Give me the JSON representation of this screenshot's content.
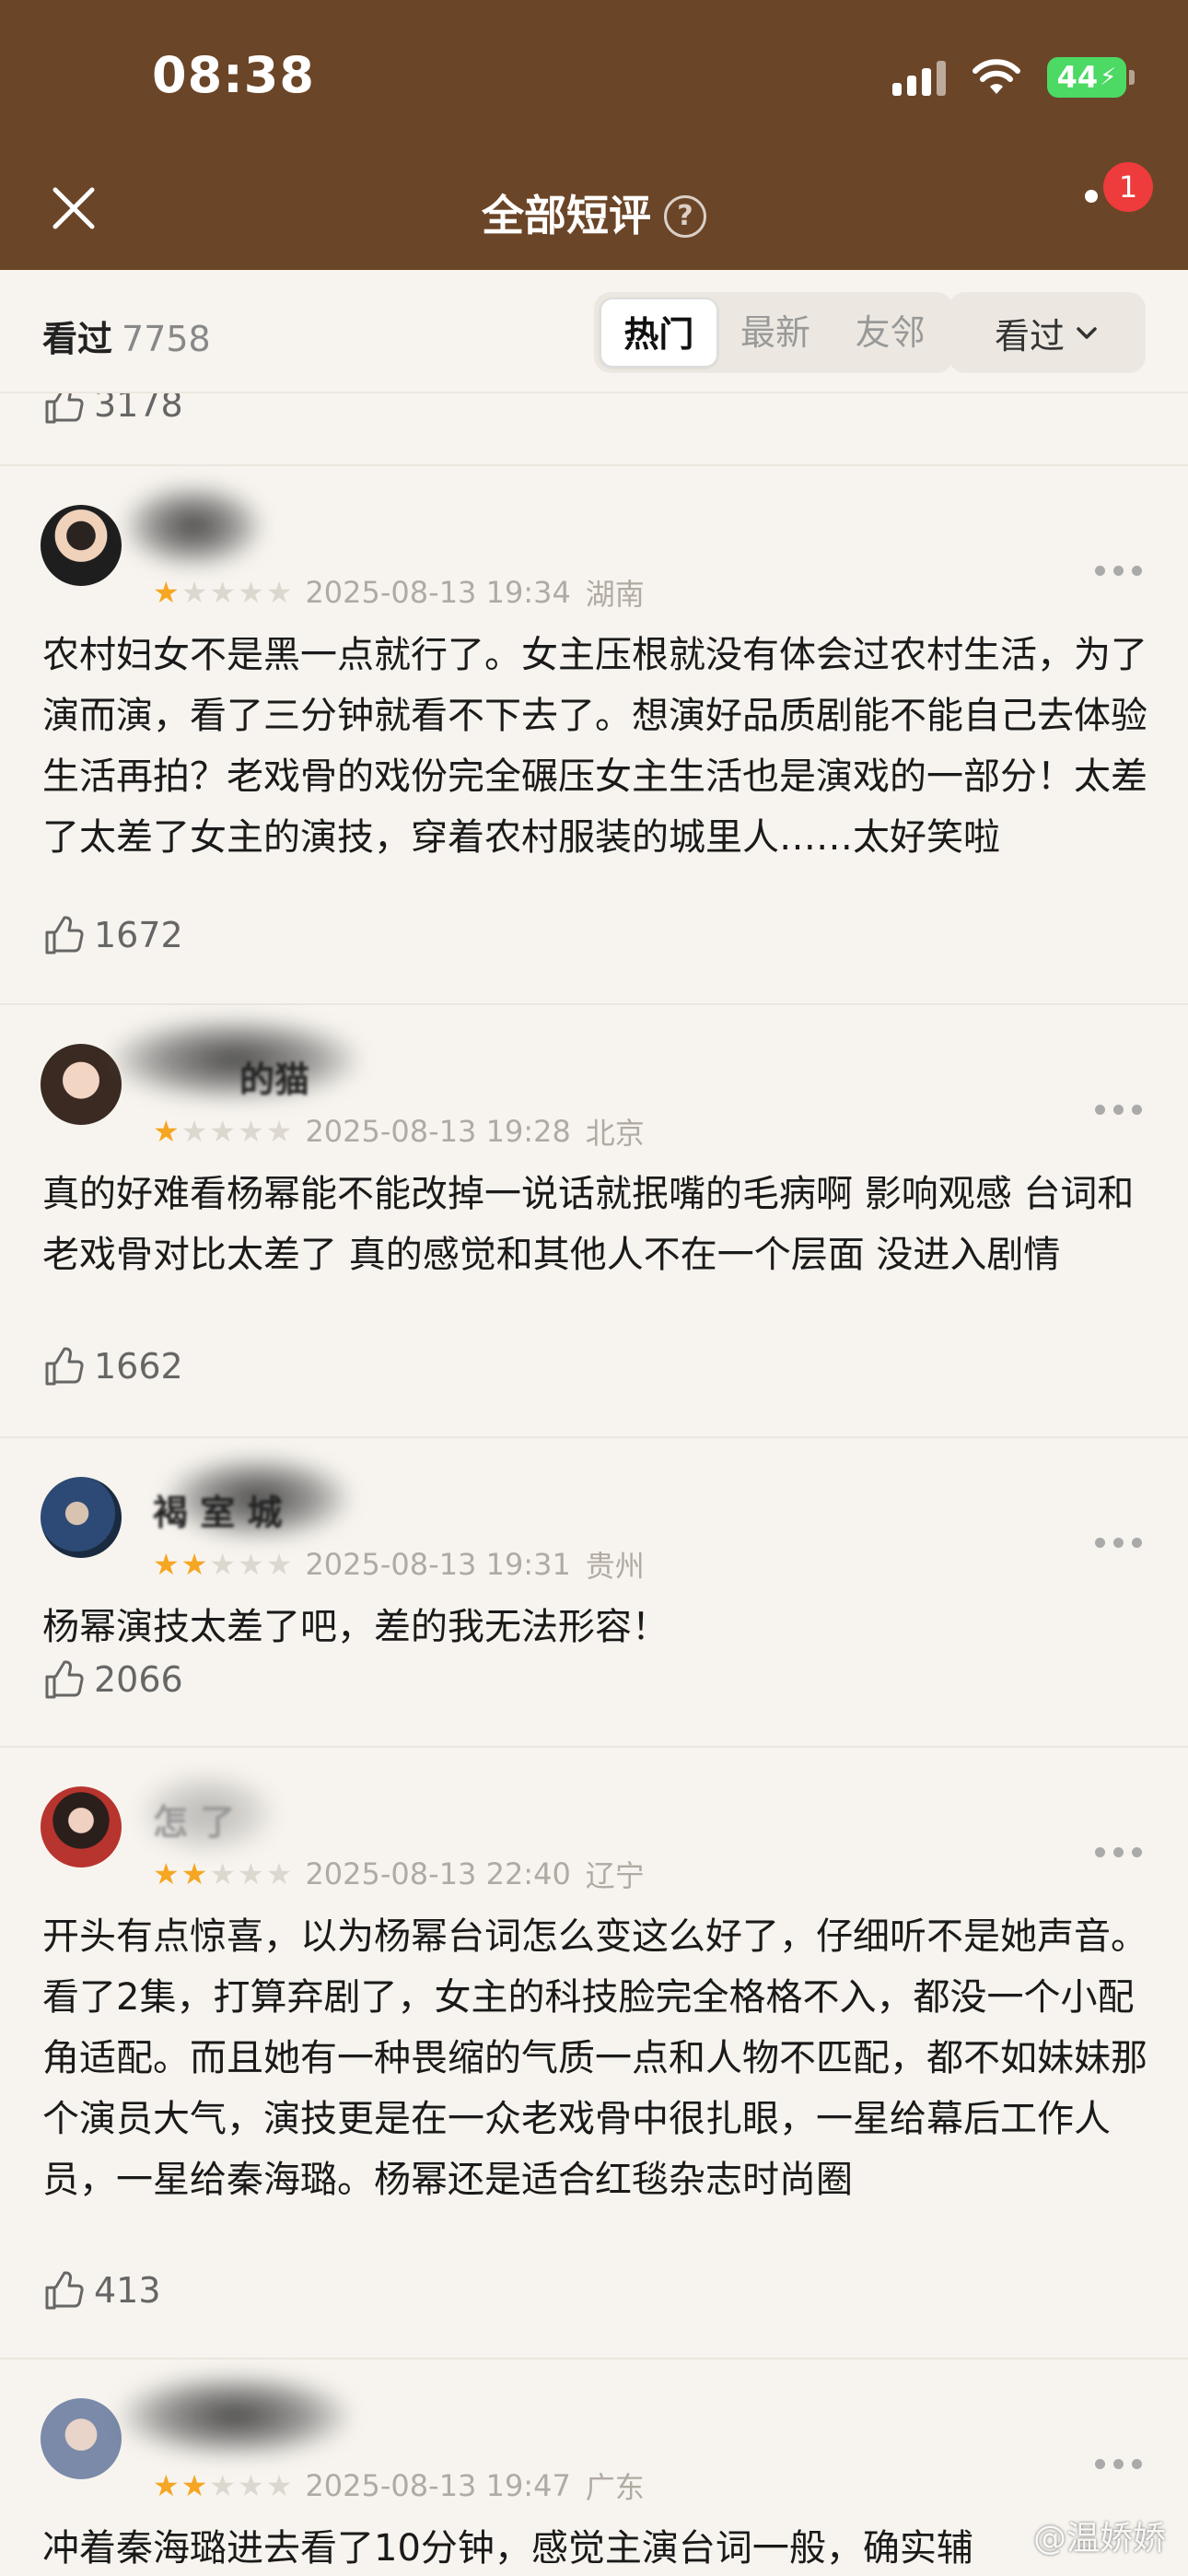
{
  "status": {
    "time": "08:38",
    "battery": "44"
  },
  "nav": {
    "title": "全部短评",
    "help": "?",
    "badge": "1"
  },
  "filter": {
    "seen_label": "看过",
    "seen_count": "7758",
    "tabs": [
      "热门",
      "最新",
      "友邻"
    ],
    "dropdown": "看过"
  },
  "top_like_count": "3178",
  "comments": [
    {
      "name": "",
      "stars": 1,
      "date": "2025-08-13 19:34",
      "location": "湖南",
      "text": "农村妇女不是黑一点就行了。女主压根就没有体会过农村生活，为了演而演，看了三分钟就看不下去了。想演好品质剧能不能自己去体验生活再拍？老戏骨的戏份完全碾压女主生活也是演戏的一部分！太差了太差了女主的演技，穿着农村服装的城里人……太好笑啦",
      "likes": "1672"
    },
    {
      "name": "的猫",
      "stars": 1,
      "date": "2025-08-13 19:28",
      "location": "北京",
      "text": "真的好难看杨幂能不能改掉一说话就抿嘴的毛病啊 影响观感 台词和老戏骨对比太差了 真的感觉和其他人不在一个层面 没进入剧情",
      "likes": "1662"
    },
    {
      "name": "褐  室  城",
      "stars": 2,
      "date": "2025-08-13 19:31",
      "location": "贵州",
      "text": "杨幂演技太差了吧，差的我无法形容！",
      "likes": "2066"
    },
    {
      "name": "怎  了",
      "stars": 2,
      "date": "2025-08-13 22:40",
      "location": "辽宁",
      "text": "开头有点惊喜，以为杨幂台词怎么变这么好了，仔细听不是她声音。看了2集，打算弃剧了，女主的科技脸完全格格不入，都没一个小配角适配。而且她有一种畏缩的气质一点和人物不匹配，都不如妹妹那个演员大气，演技更是在一众老戏骨中很扎眼，一星给幕后工作人员，一星给秦海璐。杨幂还是适合红毯杂志时尚圈",
      "likes": "413"
    },
    {
      "name": "",
      "stars": 2,
      "date": "2025-08-13 19:47",
      "location": "广东",
      "text": "冲着秦海璐进去看了10分钟，感觉主演台词一般，确实辅",
      "likes": ""
    }
  ],
  "watermark": "@温娇娇",
  "colors": {
    "header": "#6b4527",
    "star": "#f5a623",
    "badge": "#ee3b3b",
    "battery": "#4cd964"
  }
}
